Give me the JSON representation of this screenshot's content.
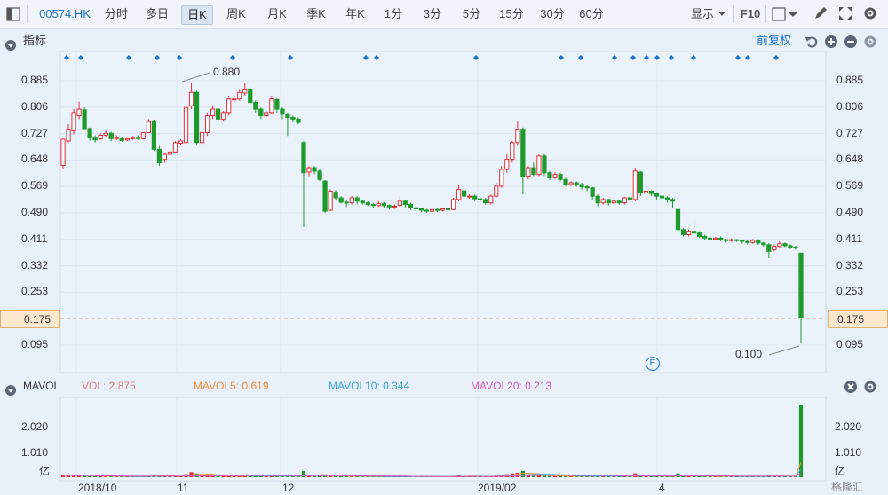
{
  "toolbar": {
    "symbol": "00574.HK",
    "periods": [
      "分时",
      "多日",
      "日K",
      "周K",
      "月K",
      "季K",
      "年K",
      "1分",
      "3分",
      "5分",
      "15分",
      "30分",
      "60分"
    ],
    "active_period": "日K",
    "display_label": "显示",
    "f10_label": "F10"
  },
  "indicator_panel": {
    "title": "指标",
    "adjust_label": "前复权"
  },
  "price_axis": [
    "0.885",
    "0.806",
    "0.727",
    "0.648",
    "0.569",
    "0.490",
    "0.411",
    "0.332",
    "0.253",
    "0.175",
    "0.095"
  ],
  "current_price": "0.175",
  "annotations": {
    "high": "0.880",
    "low": "0.100",
    "event_marker": "E"
  },
  "mavol": {
    "title": "MAVOL",
    "vol": "VOL: 2.875",
    "ma5": "MAVOL5: 0.619",
    "ma10": "MAVOL10: 0.344",
    "ma20": "MAVOL20: 0.213"
  },
  "vol_axis": [
    "2.020",
    "1.010",
    "亿"
  ],
  "x_axis": [
    "2018/10",
    "11",
    "12",
    "2019/02",
    "4"
  ],
  "watermark": "格隆汇",
  "colors": {
    "up": "#e0313a",
    "down": "#1d9a2b",
    "ma5": "#f08c3a",
    "ma10": "#3aa0e0",
    "ma20": "#e05ab4",
    "blue": "#1a73c9"
  },
  "icons": [
    "sidebar-toggle-icon",
    "chevron-down-icon",
    "draw-pen-icon",
    "fullscreen-icon",
    "settings-gear-icon",
    "undo-icon",
    "zoom-in-icon",
    "zoom-out-icon",
    "close-circle-icon"
  ],
  "chart_data": {
    "type": "candlestick",
    "ylim": [
      0.095,
      0.885
    ],
    "candles": [
      [
        0.632,
        0.71,
        0.62,
        0.715
      ],
      [
        0.705,
        0.74,
        0.7,
        0.755
      ],
      [
        0.735,
        0.79,
        0.725,
        0.8
      ],
      [
        0.78,
        0.8,
        0.77,
        0.822
      ],
      [
        0.798,
        0.742,
        0.738,
        0.805
      ],
      [
        0.742,
        0.716,
        0.705,
        0.745
      ],
      [
        0.716,
        0.708,
        0.7,
        0.722
      ],
      [
        0.712,
        0.722,
        0.708,
        0.728
      ],
      [
        0.722,
        0.728,
        0.718,
        0.738
      ],
      [
        0.728,
        0.712,
        0.705,
        0.732
      ],
      [
        0.712,
        0.716,
        0.708,
        0.722
      ],
      [
        0.714,
        0.706,
        0.702,
        0.718
      ],
      [
        0.708,
        0.712,
        0.704,
        0.716
      ],
      [
        0.712,
        0.716,
        0.708,
        0.72
      ],
      [
        0.716,
        0.712,
        0.708,
        0.722
      ],
      [
        0.712,
        0.73,
        0.71,
        0.732
      ],
      [
        0.73,
        0.765,
        0.728,
        0.77
      ],
      [
        0.765,
        0.68,
        0.675,
        0.768
      ],
      [
        0.68,
        0.64,
        0.63,
        0.69
      ],
      [
        0.65,
        0.665,
        0.64,
        0.67
      ],
      [
        0.665,
        0.672,
        0.66,
        0.68
      ],
      [
        0.672,
        0.7,
        0.668,
        0.705
      ],
      [
        0.698,
        0.705,
        0.692,
        0.71
      ],
      [
        0.7,
        0.805,
        0.695,
        0.815
      ],
      [
        0.81,
        0.85,
        0.8,
        0.88
      ],
      [
        0.85,
        0.7,
        0.695,
        0.855
      ],
      [
        0.7,
        0.73,
        0.69,
        0.74
      ],
      [
        0.73,
        0.78,
        0.72,
        0.79
      ],
      [
        0.78,
        0.8,
        0.77,
        0.812
      ],
      [
        0.8,
        0.77,
        0.765,
        0.805
      ],
      [
        0.77,
        0.79,
        0.765,
        0.795
      ],
      [
        0.79,
        0.83,
        0.78,
        0.84
      ],
      [
        0.83,
        0.83,
        0.82,
        0.84
      ],
      [
        0.83,
        0.85,
        0.825,
        0.86
      ],
      [
        0.848,
        0.86,
        0.84,
        0.878
      ],
      [
        0.86,
        0.82,
        0.815,
        0.865
      ],
      [
        0.82,
        0.8,
        0.79,
        0.826
      ],
      [
        0.8,
        0.78,
        0.77,
        0.805
      ],
      [
        0.78,
        0.79,
        0.775,
        0.795
      ],
      [
        0.79,
        0.83,
        0.785,
        0.84
      ],
      [
        0.828,
        0.8,
        0.79,
        0.832
      ],
      [
        0.8,
        0.785,
        0.77,
        0.805
      ],
      [
        0.785,
        0.775,
        0.72,
        0.79
      ],
      [
        0.775,
        0.77,
        0.76,
        0.78
      ],
      [
        0.77,
        0.76,
        0.755,
        0.775
      ],
      [
        0.7,
        0.61,
        0.448,
        0.705
      ],
      [
        0.612,
        0.625,
        0.6,
        0.63
      ],
      [
        0.625,
        0.615,
        0.605,
        0.63
      ],
      [
        0.615,
        0.59,
        0.585,
        0.62
      ],
      [
        0.585,
        0.495,
        0.49,
        0.588
      ],
      [
        0.498,
        0.555,
        0.495,
        0.56
      ],
      [
        0.552,
        0.535,
        0.53,
        0.558
      ],
      [
        0.535,
        0.522,
        0.518,
        0.54
      ],
      [
        0.522,
        0.52,
        0.508,
        0.528
      ],
      [
        0.52,
        0.535,
        0.515,
        0.54
      ],
      [
        0.535,
        0.525,
        0.515,
        0.54
      ],
      [
        0.525,
        0.52,
        0.515,
        0.53
      ],
      [
        0.52,
        0.515,
        0.51,
        0.525
      ],
      [
        0.515,
        0.512,
        0.505,
        0.52
      ],
      [
        0.512,
        0.518,
        0.508,
        0.525
      ],
      [
        0.518,
        0.512,
        0.505,
        0.522
      ],
      [
        0.512,
        0.508,
        0.5,
        0.515
      ],
      [
        0.508,
        0.51,
        0.502,
        0.515
      ],
      [
        0.512,
        0.525,
        0.508,
        0.54
      ],
      [
        0.525,
        0.515,
        0.505,
        0.528
      ],
      [
        0.515,
        0.505,
        0.498,
        0.52
      ],
      [
        0.505,
        0.502,
        0.495,
        0.51
      ],
      [
        0.502,
        0.498,
        0.492,
        0.505
      ],
      [
        0.498,
        0.495,
        0.49,
        0.502
      ],
      [
        0.495,
        0.5,
        0.49,
        0.505
      ],
      [
        0.5,
        0.498,
        0.492,
        0.504
      ],
      [
        0.498,
        0.502,
        0.494,
        0.506
      ],
      [
        0.502,
        0.5,
        0.495,
        0.508
      ],
      [
        0.5,
        0.53,
        0.498,
        0.535
      ],
      [
        0.53,
        0.56,
        0.525,
        0.575
      ],
      [
        0.556,
        0.54,
        0.535,
        0.56
      ],
      [
        0.54,
        0.54,
        0.532,
        0.545
      ],
      [
        0.54,
        0.532,
        0.525,
        0.545
      ],
      [
        0.532,
        0.53,
        0.522,
        0.538
      ],
      [
        0.53,
        0.52,
        0.515,
        0.535
      ],
      [
        0.52,
        0.54,
        0.515,
        0.545
      ],
      [
        0.54,
        0.57,
        0.535,
        0.58
      ],
      [
        0.57,
        0.62,
        0.565,
        0.63
      ],
      [
        0.62,
        0.65,
        0.61,
        0.665
      ],
      [
        0.65,
        0.7,
        0.64,
        0.705
      ],
      [
        0.7,
        0.74,
        0.69,
        0.765
      ],
      [
        0.74,
        0.6,
        0.545,
        0.745
      ],
      [
        0.6,
        0.625,
        0.59,
        0.63
      ],
      [
        0.625,
        0.605,
        0.6,
        0.64
      ],
      [
        0.605,
        0.66,
        0.6,
        0.665
      ],
      [
        0.66,
        0.61,
        0.6,
        0.665
      ],
      [
        0.61,
        0.595,
        0.588,
        0.615
      ],
      [
        0.595,
        0.605,
        0.59,
        0.612
      ],
      [
        0.605,
        0.59,
        0.585,
        0.61
      ],
      [
        0.59,
        0.575,
        0.57,
        0.595
      ],
      [
        0.575,
        0.58,
        0.57,
        0.585
      ],
      [
        0.58,
        0.575,
        0.568,
        0.585
      ],
      [
        0.575,
        0.568,
        0.56,
        0.58
      ],
      [
        0.568,
        0.565,
        0.555,
        0.572
      ],
      [
        0.565,
        0.54,
        0.53,
        0.568
      ],
      [
        0.54,
        0.52,
        0.51,
        0.545
      ],
      [
        0.52,
        0.53,
        0.515,
        0.535
      ],
      [
        0.53,
        0.52,
        0.512,
        0.532
      ],
      [
        0.52,
        0.525,
        0.515,
        0.53
      ],
      [
        0.525,
        0.52,
        0.515,
        0.53
      ],
      [
        0.52,
        0.535,
        0.515,
        0.538
      ],
      [
        0.535,
        0.53,
        0.525,
        0.54
      ],
      [
        0.53,
        0.615,
        0.525,
        0.625
      ],
      [
        0.612,
        0.55,
        0.54,
        0.615
      ],
      [
        0.55,
        0.555,
        0.545,
        0.56
      ],
      [
        0.555,
        0.548,
        0.54,
        0.558
      ],
      [
        0.548,
        0.54,
        0.53,
        0.552
      ],
      [
        0.54,
        0.535,
        0.525,
        0.545
      ],
      [
        0.535,
        0.53,
        0.52,
        0.54
      ],
      [
        0.53,
        0.525,
        0.505,
        0.535
      ],
      [
        0.5,
        0.44,
        0.4,
        0.505
      ],
      [
        0.44,
        0.425,
        0.42,
        0.445
      ],
      [
        0.425,
        0.435,
        0.42,
        0.44
      ],
      [
        0.435,
        0.43,
        0.425,
        0.47
      ],
      [
        0.43,
        0.42,
        0.415,
        0.435
      ],
      [
        0.42,
        0.415,
        0.41,
        0.425
      ],
      [
        0.415,
        0.412,
        0.408,
        0.418
      ],
      [
        0.412,
        0.415,
        0.408,
        0.418
      ],
      [
        0.415,
        0.41,
        0.405,
        0.42
      ],
      [
        0.41,
        0.408,
        0.402,
        0.413
      ],
      [
        0.408,
        0.41,
        0.404,
        0.414
      ],
      [
        0.41,
        0.408,
        0.403,
        0.412
      ],
      [
        0.408,
        0.405,
        0.398,
        0.41
      ],
      [
        0.405,
        0.402,
        0.396,
        0.408
      ],
      [
        0.402,
        0.408,
        0.398,
        0.412
      ],
      [
        0.408,
        0.4,
        0.395,
        0.412
      ],
      [
        0.4,
        0.395,
        0.39,
        0.404
      ],
      [
        0.395,
        0.375,
        0.355,
        0.4
      ],
      [
        0.38,
        0.39,
        0.375,
        0.395
      ],
      [
        0.39,
        0.398,
        0.385,
        0.405
      ],
      [
        0.398,
        0.392,
        0.388,
        0.402
      ],
      [
        0.392,
        0.388,
        0.382,
        0.396
      ],
      [
        0.388,
        0.385,
        0.38,
        0.392
      ],
      [
        0.37,
        0.175,
        0.1,
        0.37
      ]
    ],
    "volumes": [
      0.08,
      0.06,
      0.07,
      0.09,
      0.05,
      0.04,
      0.03,
      0.03,
      0.04,
      0.03,
      0.03,
      0.02,
      0.03,
      0.02,
      0.02,
      0.03,
      0.05,
      0.08,
      0.06,
      0.04,
      0.03,
      0.04,
      0.03,
      0.12,
      0.2,
      0.15,
      0.08,
      0.06,
      0.07,
      0.04,
      0.05,
      0.06,
      0.04,
      0.05,
      0.05,
      0.07,
      0.05,
      0.04,
      0.03,
      0.05,
      0.04,
      0.03,
      0.06,
      0.04,
      0.03,
      0.25,
      0.06,
      0.05,
      0.05,
      0.1,
      0.06,
      0.04,
      0.03,
      0.03,
      0.04,
      0.03,
      0.03,
      0.02,
      0.02,
      0.03,
      0.02,
      0.02,
      0.03,
      0.05,
      0.03,
      0.03,
      0.02,
      0.02,
      0.02,
      0.03,
      0.02,
      0.02,
      0.02,
      0.05,
      0.07,
      0.04,
      0.03,
      0.03,
      0.03,
      0.03,
      0.04,
      0.06,
      0.09,
      0.12,
      0.15,
      0.18,
      0.25,
      0.08,
      0.06,
      0.07,
      0.06,
      0.05,
      0.04,
      0.04,
      0.04,
      0.03,
      0.03,
      0.03,
      0.03,
      0.05,
      0.06,
      0.04,
      0.03,
      0.03,
      0.03,
      0.04,
      0.03,
      0.15,
      0.08,
      0.04,
      0.03,
      0.03,
      0.03,
      0.03,
      0.04,
      0.15,
      0.06,
      0.05,
      0.05,
      0.04,
      0.03,
      0.03,
      0.03,
      0.03,
      0.03,
      0.03,
      0.03,
      0.03,
      0.03,
      0.03,
      0.03,
      0.03,
      0.08,
      0.04,
      0.04,
      0.03,
      0.03,
      0.03,
      2.875
    ]
  }
}
